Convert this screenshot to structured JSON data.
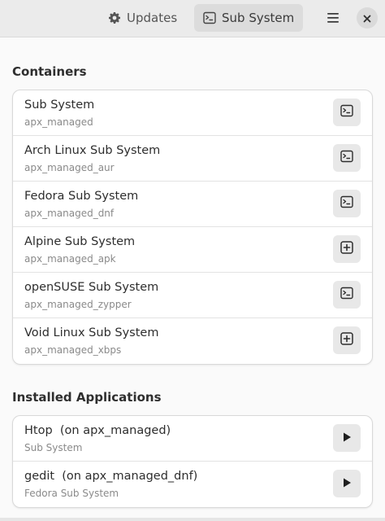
{
  "header": {
    "tabs": [
      {
        "label": "Updates",
        "icon": "gear-icon",
        "active": false
      },
      {
        "label": "Sub System",
        "icon": "terminal-icon",
        "active": true
      }
    ],
    "menu_icon": "hamburger-menu-icon",
    "close_icon": "close-icon"
  },
  "containers": {
    "title": "Containers",
    "items": [
      {
        "title": "Sub System",
        "subtitle": "apx_managed",
        "action_icon": "terminal-icon"
      },
      {
        "title": "Arch Linux Sub System",
        "subtitle": "apx_managed_aur",
        "action_icon": "terminal-icon"
      },
      {
        "title": "Fedora Sub System",
        "subtitle": "apx_managed_dnf",
        "action_icon": "terminal-icon"
      },
      {
        "title": "Alpine Sub System",
        "subtitle": "apx_managed_apk",
        "action_icon": "add-box-icon"
      },
      {
        "title": "openSUSE Sub System",
        "subtitle": "apx_managed_zypper",
        "action_icon": "terminal-icon"
      },
      {
        "title": "Void Linux Sub System",
        "subtitle": "apx_managed_xbps",
        "action_icon": "add-box-icon"
      }
    ]
  },
  "installed": {
    "title": "Installed Applications",
    "items": [
      {
        "title": "Htop  (on apx_managed)",
        "subtitle": "Sub System",
        "action_icon": "play-icon"
      },
      {
        "title": "gedit  (on apx_managed_dnf)",
        "subtitle": "Fedora Sub System",
        "action_icon": "play-icon"
      }
    ]
  }
}
